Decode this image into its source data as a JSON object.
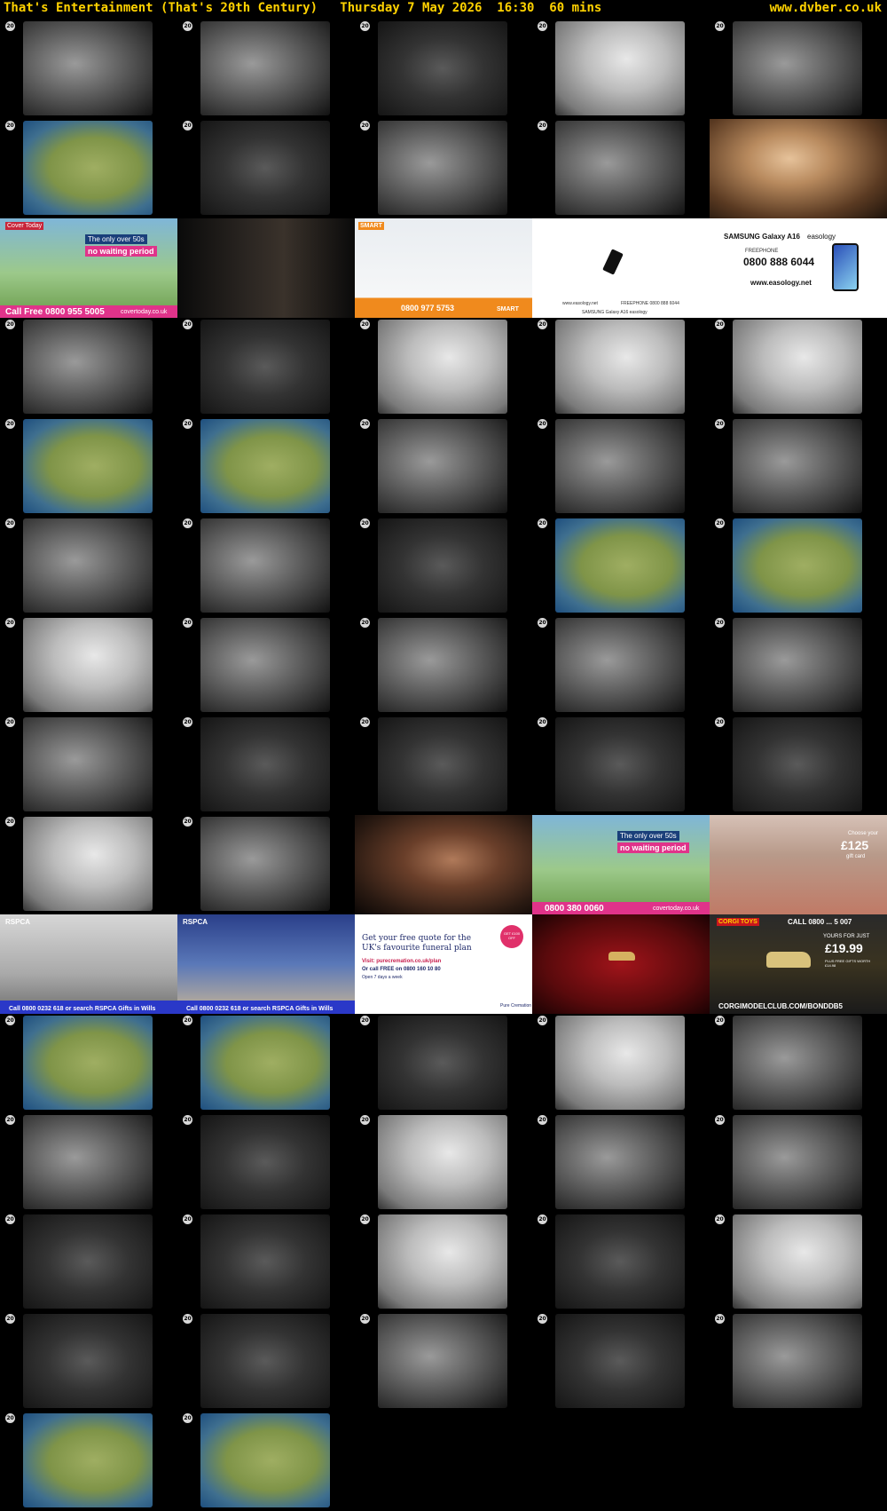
{
  "header": {
    "title": "That's Entertainment (That's 20th Century)   Thursday 7 May 2026  16:30  60 mins",
    "site": "www.dvber.co.uk"
  },
  "colors": {
    "header_text": "#ffd200",
    "background": "#000000"
  },
  "channel_logo": {
    "icon": "channel-logo-icon",
    "text": "20"
  },
  "thumbnails": [
    {
      "type": "bw",
      "variant": "normal"
    },
    {
      "type": "bw",
      "variant": "normal"
    },
    {
      "type": "bw",
      "variant": "dark"
    },
    {
      "type": "bw",
      "variant": "light"
    },
    {
      "type": "bw",
      "variant": "normal"
    },
    {
      "type": "map",
      "variant": "normal"
    },
    {
      "type": "bw",
      "variant": "dark"
    },
    {
      "type": "bw",
      "variant": "normal"
    },
    {
      "type": "bw",
      "variant": "normal"
    },
    {
      "type": "color",
      "variant": "normal"
    },
    {
      "type": "ad",
      "ad": "cover1"
    },
    {
      "type": "ad",
      "ad": "dark"
    },
    {
      "type": "ad",
      "ad": "smart"
    },
    {
      "type": "ad",
      "ad": "phone"
    },
    {
      "type": "ad",
      "ad": "samsung"
    },
    {
      "type": "bw",
      "variant": "normal"
    },
    {
      "type": "bw",
      "variant": "dark"
    },
    {
      "type": "bw",
      "variant": "light"
    },
    {
      "type": "bw",
      "variant": "light"
    },
    {
      "type": "bw",
      "variant": "light"
    },
    {
      "type": "map",
      "variant": "normal"
    },
    {
      "type": "map",
      "variant": "normal"
    },
    {
      "type": "bw",
      "variant": "normal"
    },
    {
      "type": "bw",
      "variant": "normal"
    },
    {
      "type": "bw",
      "variant": "normal"
    },
    {
      "type": "bw",
      "variant": "normal"
    },
    {
      "type": "bw",
      "variant": "normal"
    },
    {
      "type": "bw",
      "variant": "dark"
    },
    {
      "type": "map",
      "variant": "normal"
    },
    {
      "type": "map",
      "variant": "normal"
    },
    {
      "type": "bw",
      "variant": "light"
    },
    {
      "type": "bw",
      "variant": "normal"
    },
    {
      "type": "bw",
      "variant": "normal"
    },
    {
      "type": "bw",
      "variant": "normal"
    },
    {
      "type": "bw",
      "variant": "normal"
    },
    {
      "type": "bw",
      "variant": "normal"
    },
    {
      "type": "bw",
      "variant": "dark"
    },
    {
      "type": "bw",
      "variant": "dark"
    },
    {
      "type": "bw",
      "variant": "dark"
    },
    {
      "type": "bw",
      "variant": "dark"
    },
    {
      "type": "bw",
      "variant": "light"
    },
    {
      "type": "bw",
      "variant": "normal"
    },
    {
      "type": "color",
      "variant": "dark"
    },
    {
      "type": "ad",
      "ad": "cover2"
    },
    {
      "type": "ad",
      "ad": "cafe"
    },
    {
      "type": "ad",
      "ad": "rspca1"
    },
    {
      "type": "ad",
      "ad": "rspca2"
    },
    {
      "type": "ad",
      "ad": "pure"
    },
    {
      "type": "ad",
      "ad": "car"
    },
    {
      "type": "ad",
      "ad": "corgi"
    },
    {
      "type": "map",
      "variant": "normal"
    },
    {
      "type": "map",
      "variant": "normal"
    },
    {
      "type": "bw",
      "variant": "dark"
    },
    {
      "type": "bw",
      "variant": "light"
    },
    {
      "type": "bw",
      "variant": "normal"
    },
    {
      "type": "bw",
      "variant": "normal"
    },
    {
      "type": "bw",
      "variant": "dark"
    },
    {
      "type": "bw",
      "variant": "light"
    },
    {
      "type": "bw",
      "variant": "normal"
    },
    {
      "type": "bw",
      "variant": "normal"
    },
    {
      "type": "bw",
      "variant": "dark"
    },
    {
      "type": "bw",
      "variant": "dark"
    },
    {
      "type": "bw",
      "variant": "light"
    },
    {
      "type": "bw",
      "variant": "dark"
    },
    {
      "type": "bw",
      "variant": "light"
    },
    {
      "type": "bw",
      "variant": "dark"
    },
    {
      "type": "bw",
      "variant": "dark"
    },
    {
      "type": "bw",
      "variant": "normal"
    },
    {
      "type": "bw",
      "variant": "dark"
    },
    {
      "type": "bw",
      "variant": "normal"
    },
    {
      "type": "map",
      "variant": "normal"
    },
    {
      "type": "map",
      "variant": "normal"
    }
  ],
  "ads": {
    "cover1": {
      "brand": "Cover Today",
      "line1": "The only over 50s",
      "line2": "no waiting period",
      "phone": "Call Free 0800 955 5005",
      "url": "covertoday.co.uk"
    },
    "smart": {
      "brand": "SMART",
      "phone": "0800 977 5753",
      "tag": "SMART"
    },
    "phone": {
      "url": "www.easology.net",
      "freephone": "FREEPHONE 0800 888 6044",
      "sub": "SAMSUNG Galaxy A16  easology"
    },
    "samsung": {
      "brand": "SAMSUNG Galaxy A16",
      "partner": "easology",
      "label": "FREEPHONE",
      "phone": "0800 888 6044",
      "url": "www.easology.net"
    },
    "cover2": {
      "line1": "The only over 50s",
      "line2": "no waiting period",
      "phone": "0800 380 0060",
      "url": "covertoday.co.uk"
    },
    "cafe": {
      "label": "Choose your",
      "amount": "£125",
      "sub": "gift card"
    },
    "rspca1": {
      "brand": "RSPCA",
      "bar": "Call 0800 0232 618 or search RSPCA Gifts in Wills"
    },
    "rspca2": {
      "brand": "RSPCA",
      "bar": "Call 0800 0232 618 or search RSPCA Gifts in Wills"
    },
    "pure": {
      "headline1": "Get your free quote for the",
      "headline2": "UK's favourite funeral plan",
      "visit": "Visit: purecremation.co.uk/plan",
      "call": "Or call FREE on 0800 160 10 80",
      "open": "Open 7 days a week",
      "badge": "GET £100 OFF",
      "brand": "Pure Cremation"
    },
    "corgi": {
      "brand": "CORGI TOYS",
      "call": "CALL 0800 ... 5 007",
      "yours": "YOURS FOR JUST",
      "price": "£19.99",
      "plus": "PLUS FREE GIFTS WORTH £14.98",
      "url": "CORGIMODELCLUB.COM/BONDDB5"
    }
  }
}
